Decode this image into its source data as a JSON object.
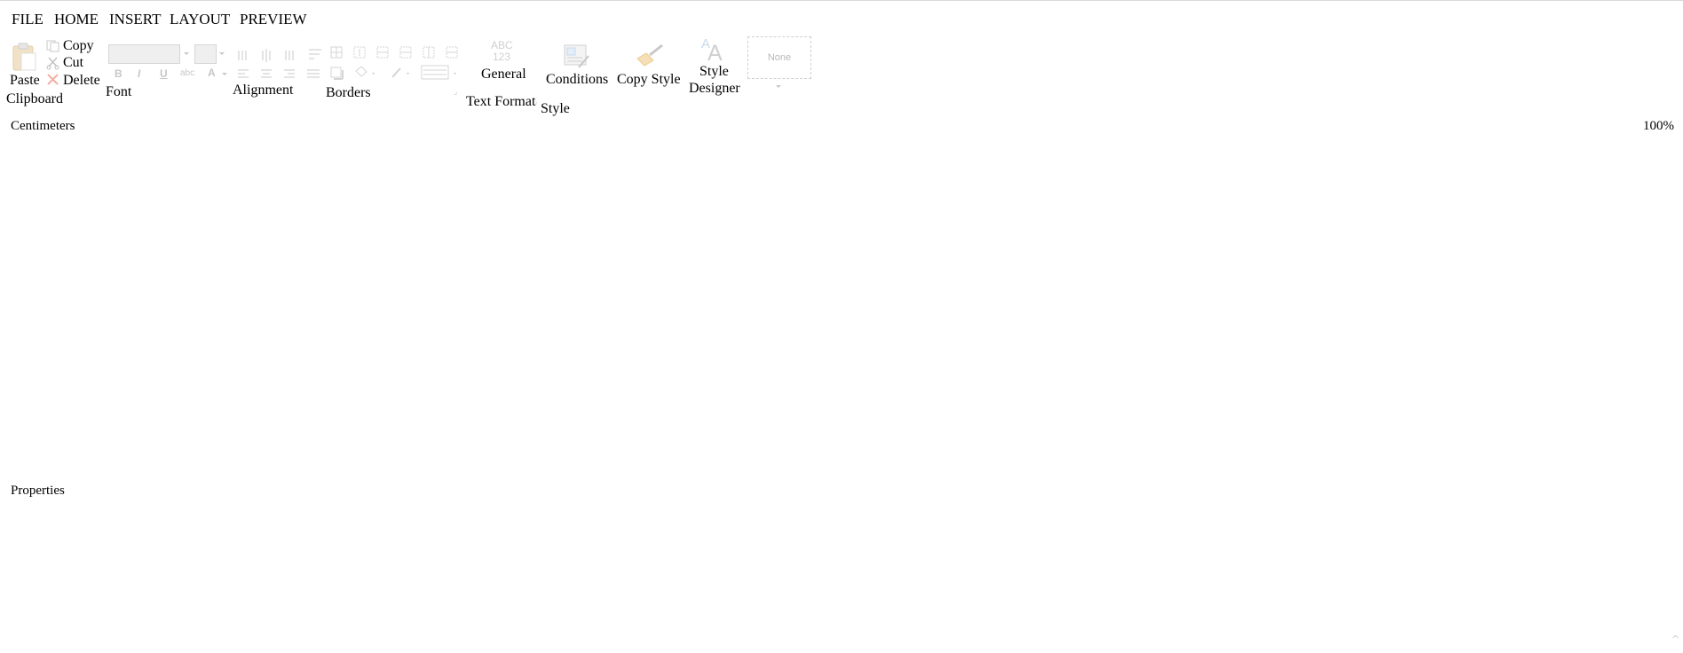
{
  "menu": [
    "FILE",
    "HOME",
    "INSERT",
    "LAYOUT",
    "PREVIEW"
  ],
  "clipboard": {
    "paste": "Paste",
    "copy": "Copy",
    "cut": "Cut",
    "delete": "Delete",
    "group": "Clipboard"
  },
  "font": {
    "group": "Font",
    "bold": "B",
    "italic": "I",
    "underline": "U",
    "strike": "abc",
    "color": "A"
  },
  "alignment": {
    "group": "Alignment"
  },
  "borders": {
    "group": "Borders"
  },
  "text_format": {
    "icon_text_top": "ABC",
    "icon_text_bottom": "123",
    "value": "General",
    "group": "Text Format"
  },
  "style": {
    "conditions": "Conditions",
    "copy_style": "Copy Style",
    "designer_line1": "Style",
    "designer_line2": "Designer",
    "none": "None",
    "group": "Style"
  },
  "ruler": {
    "units": "Centimeters",
    "zoom": "100%"
  },
  "panels": {
    "properties": "Properties"
  }
}
